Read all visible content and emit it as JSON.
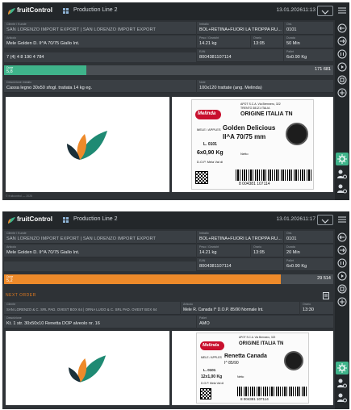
{
  "app": {
    "logo_text": "fruitControl"
  },
  "colors": {
    "topbar": "#23272a",
    "bg": "#2e3236",
    "green": "#3fb38a",
    "orange": "#ee8a2a",
    "accent": "#e07a1f"
  },
  "screens": [
    {
      "header": {
        "line": "Production Line 2",
        "date": "13.01.2026",
        "time": "11:13"
      },
      "row1": {
        "customer_label": "Cliente / Kunde",
        "customer_value": "SAN LORENZO IMPORT EXPORT | SAN LORENZO IMPORT EXPORT",
        "customer_id_label": "ID / Nr.",
        "customer_id_value": "",
        "pack_label": "Imballo",
        "pack_value": "BOL+RETINA+FUORI LA TROPPA RU...",
        "ord_label": "Ord.",
        "ord_value": "0101"
      },
      "row2": {
        "article_label": "Articolo",
        "article_value": "Mele Golden D. II^A 70/75 Giallo Int.",
        "weight_label": "Peso / Gewicht",
        "weight_value": "14.21 kg",
        "time_label": "Orario",
        "time_value": "13:05",
        "duration_label": "Durata",
        "duration_value": "50 Min"
      },
      "row3": {
        "stats": "7 (4)  4  8  190  4  784",
        "ean_label": "EAN",
        "ean_value": "8004381107114",
        "pallet_label": "Pallet",
        "pallet_value": "6x0.90 Kg"
      },
      "progress": {
        "label": "Done",
        "value_text": "5,8",
        "count": "171  681",
        "fraction": 0.25,
        "color": "#3fb38a"
      },
      "row4": {
        "pack_desc_label": "Descrizione imballo",
        "pack_desc_value": "Cassa legno 30x50 sfogl. tratiata 14 kg eg.",
        "notes_label": "Note",
        "notes_value": "100x120 trattate (ang. Melinda)"
      },
      "footer": "© fruitcontrol — 2026",
      "label": {
        "header1": "APOT S.C.A. Via Brennero, 322",
        "header2": "TRENTO  38121 ITALIA",
        "origin": "ORIGINE ITALIA TN",
        "brand": "Melinda",
        "category": "MELE / APPLES",
        "variety": "Golden Delicious",
        "grade": "II^A 70/75 mm",
        "lot": "L. 0101",
        "weight": "6x0,90 Kg",
        "netto": "Netto",
        "dop": "D.O.P. Mela Val di",
        "code": "8 004381 107114"
      }
    },
    {
      "header": {
        "line": "Production Line 2",
        "date": "13.01.2026",
        "time": "11:17"
      },
      "row1": {
        "customer_label": "Cliente / Kunde",
        "customer_value": "SAN LORENZO IMPORT EXPORT | SAN LORENZO IMPORT EXPORT",
        "customer_id_label": "ID / Nr.",
        "customer_id_value": "",
        "pack_label": "Imballo",
        "pack_value": "BOL+RETINA+FUORI LA TROPPA RU...",
        "ord_label": "Ord.",
        "ord_value": "0101"
      },
      "row2": {
        "article_label": "Articolo",
        "article_value": "Mele Golden D. II^A 70/75 Giallo Int.",
        "weight_label": "Peso / Gewicht",
        "weight_value": "14.21 kg",
        "time_label": "Orario",
        "time_value": "13:05",
        "duration_label": "Durata",
        "duration_value": "20 Min"
      },
      "row3": {
        "ean_label": "EAN",
        "ean_value": "8004381107114",
        "pallet_label": "Pallet",
        "pallet_value": "6x0.90 Kg"
      },
      "progress": {
        "label": "Done",
        "value_text": "5,2",
        "count": "29  514",
        "fraction": 0.84,
        "color": "#ee8a2a"
      },
      "next_order": {
        "title": "NEXT ORDER",
        "customer_label": "Cliente",
        "customer_value": "SAN LORENZO & C. SRL PAD. OVEST BOX 64 | ORNA LUGO & C. SRL PAD. OVEST BOX 64",
        "article_label": "Articolo",
        "article_value": "Mele R. Canada I^ D.O.P. 85/90 Normale Int.",
        "time_label": "Orario",
        "time_value": "13:30",
        "desc_label": "Descrizione",
        "desc_value": "Kt. 1 str. 30x50x10 Renetta DOP alveolo nr. 16",
        "pallet_label": "Pallet",
        "pallet_value": "AMO"
      },
      "label": {
        "header1": "APOT S.C.A. Via Brennero, 322",
        "origin": "ORIGINE ITALIA TN",
        "brand": "Melinda",
        "category": "MELE / APPLES",
        "variety": "Renetta Canada",
        "grade": "I^ 85/90",
        "lot": "L. 0101",
        "weight": "12x1,00 Kg",
        "netto": "Netto",
        "dop": "D.O.P. Mela Val di",
        "code": "8 004381 107114"
      }
    }
  ]
}
